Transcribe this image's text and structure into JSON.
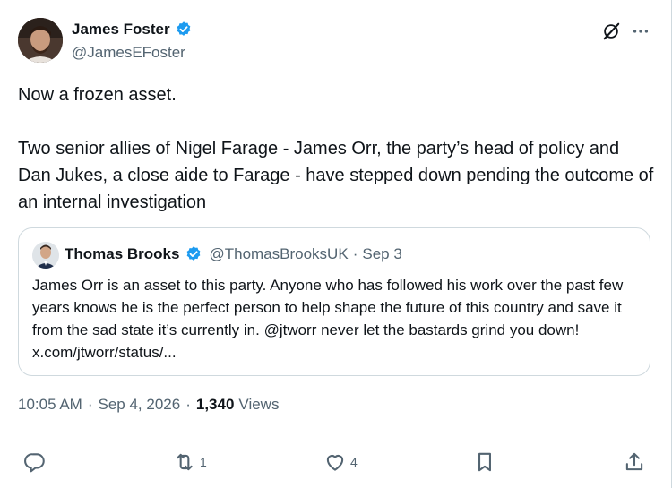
{
  "author": {
    "name": "James Foster",
    "handle": "@JamesEFoster"
  },
  "tweet": {
    "text": "Now a frozen asset.\n\nTwo senior allies of Nigel Farage - James Orr, the party’s head of policy and Dan Jukes, a close aide to Farage - have stepped down pending the outcome of an internal investigation"
  },
  "quoted": {
    "name": "Thomas Brooks",
    "handle": "@ThomasBrooksUK",
    "separator": "·",
    "date": "Sep 3",
    "text": "James Orr is an asset to this party. Anyone who has followed his work over the past few years knows he is the perfect person to help shape the future of this country and save it from the sad state it’s currently in. @jtworr never let the bastards grind you down! x.com/jtworr/status/..."
  },
  "meta": {
    "time": "10:05 AM",
    "separator": "·",
    "date": "Sep 4, 2026",
    "views_count": "1,340",
    "views_label": "Views"
  },
  "actions": {
    "replies": "",
    "reposts": "1",
    "likes": "4"
  },
  "colors": {
    "verified": "#1d9bf0",
    "secondary_text": "#536471",
    "border": "#cfd9de"
  }
}
